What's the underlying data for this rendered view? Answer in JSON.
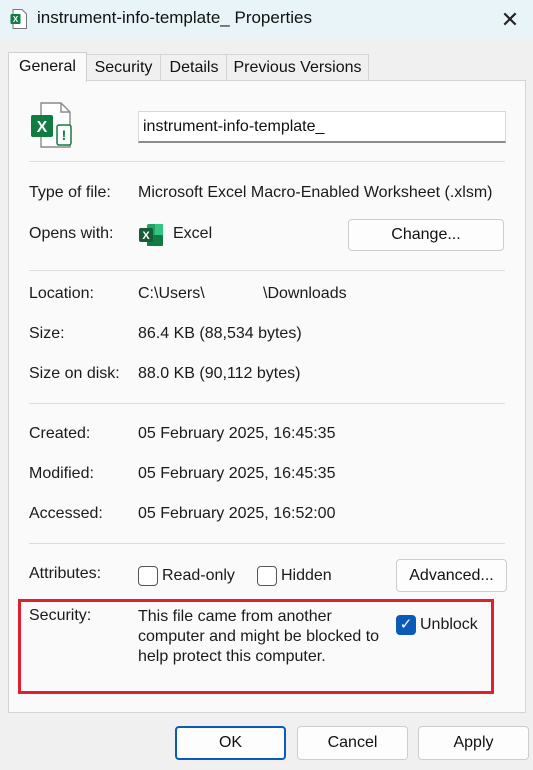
{
  "window": {
    "title": "instrument-info-template_ Properties",
    "close_glyph": "✕"
  },
  "tabs": [
    {
      "label": "General",
      "active": true
    },
    {
      "label": "Security",
      "active": false
    },
    {
      "label": "Details",
      "active": false
    },
    {
      "label": "Previous Versions",
      "active": false
    }
  ],
  "general": {
    "file_name": "instrument-info-template_",
    "type_label": "Type of file:",
    "type_value": "Microsoft Excel Macro-Enabled Worksheet (.xlsm)",
    "opens_label": "Opens with:",
    "opens_app": "Excel",
    "change_button": "Change...",
    "location_label": "Location:",
    "location_part1": "C:\\Users\\",
    "location_part2": "\\Downloads",
    "size_label": "Size:",
    "size_value": "86.4 KB (88,534 bytes)",
    "size_on_disk_label": "Size on disk:",
    "size_on_disk_value": "88.0 KB (90,112 bytes)",
    "created_label": "Created:",
    "created_value": "05 February 2025, 16:45:35",
    "modified_label": "Modified:",
    "modified_value": "05 February 2025, 16:45:35",
    "accessed_label": "Accessed:",
    "accessed_value": "05 February 2025, 16:52:00",
    "attributes_label": "Attributes:",
    "readonly_label": "Read-only",
    "readonly_checked": false,
    "hidden_label": "Hidden",
    "hidden_checked": false,
    "advanced_button": "Advanced...",
    "security_label": "Security:",
    "security_text_1": "This file came from another",
    "security_text_2": "computer and might be blocked to",
    "security_text_3": "help protect this computer.",
    "unblock_label": "Unblock",
    "unblock_checked": true,
    "checkmark_glyph": "✓",
    "highlight_color": "#e0202e"
  },
  "footer": {
    "ok": "OK",
    "cancel": "Cancel",
    "apply": "Apply"
  },
  "colors": {
    "excel_green": "#107c41",
    "accent_blue": "#0a5bb8"
  }
}
